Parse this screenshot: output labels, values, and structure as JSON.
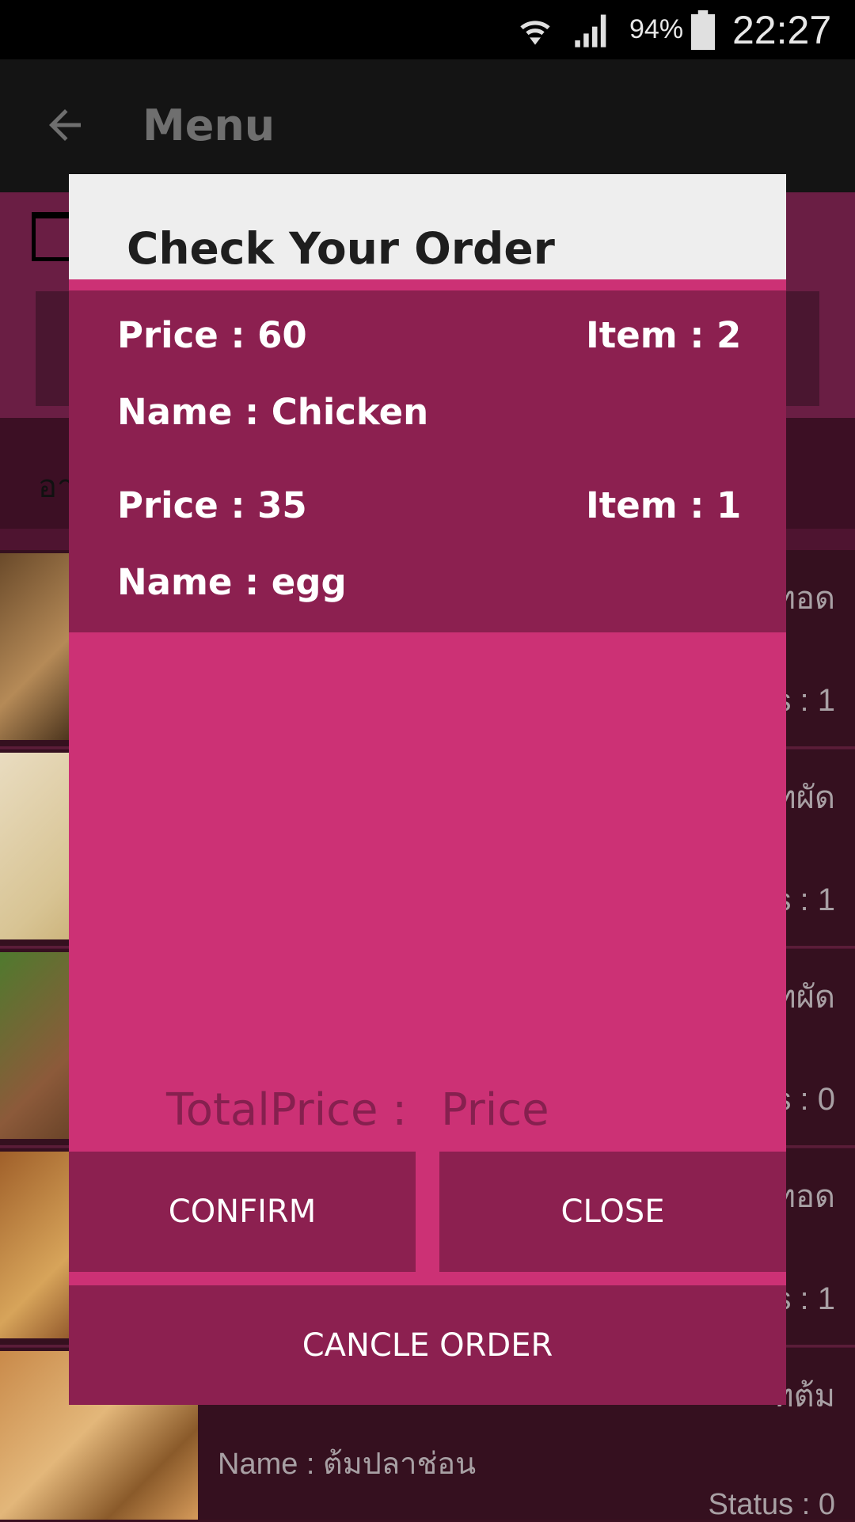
{
  "status_bar": {
    "battery_percent": "94%",
    "time": "22:27",
    "icons": [
      "wifi-icon",
      "signal-icon",
      "battery-icon"
    ]
  },
  "toolbar": {
    "title": "Menu",
    "back_icon": "arrow-left-icon"
  },
  "background": {
    "category_label": "อา",
    "rows": [
      {
        "a": "ทอด",
        "b": "s : 1"
      },
      {
        "a": "ทผัด",
        "b": "s : 1"
      },
      {
        "a": "ทผัด",
        "b": "s : 0"
      },
      {
        "a": "ทอด",
        "b": "s : 1"
      },
      {
        "a": "ทต้ม",
        "b": ""
      }
    ],
    "bottom_name": "Name : ต้มปลาช่อน",
    "bottom_status": "Status : 0"
  },
  "dialog": {
    "title": "Check Your Order",
    "orders": [
      {
        "price": "Price : 60",
        "item": "Item : 2",
        "name": "Name : Chicken"
      },
      {
        "price": "Price : 35",
        "item": "Item : 1",
        "name": "Name : egg"
      }
    ],
    "total_label": "TotalPrice :",
    "total_value": "Price",
    "confirm_label": "CONFIRM",
    "close_label": "CLOSE",
    "cancel_label": "CANCLE ORDER"
  },
  "colors": {
    "accent_pink": "#cc3175",
    "dark_pink": "#8c2050",
    "dialog_header": "#eeeeee"
  }
}
